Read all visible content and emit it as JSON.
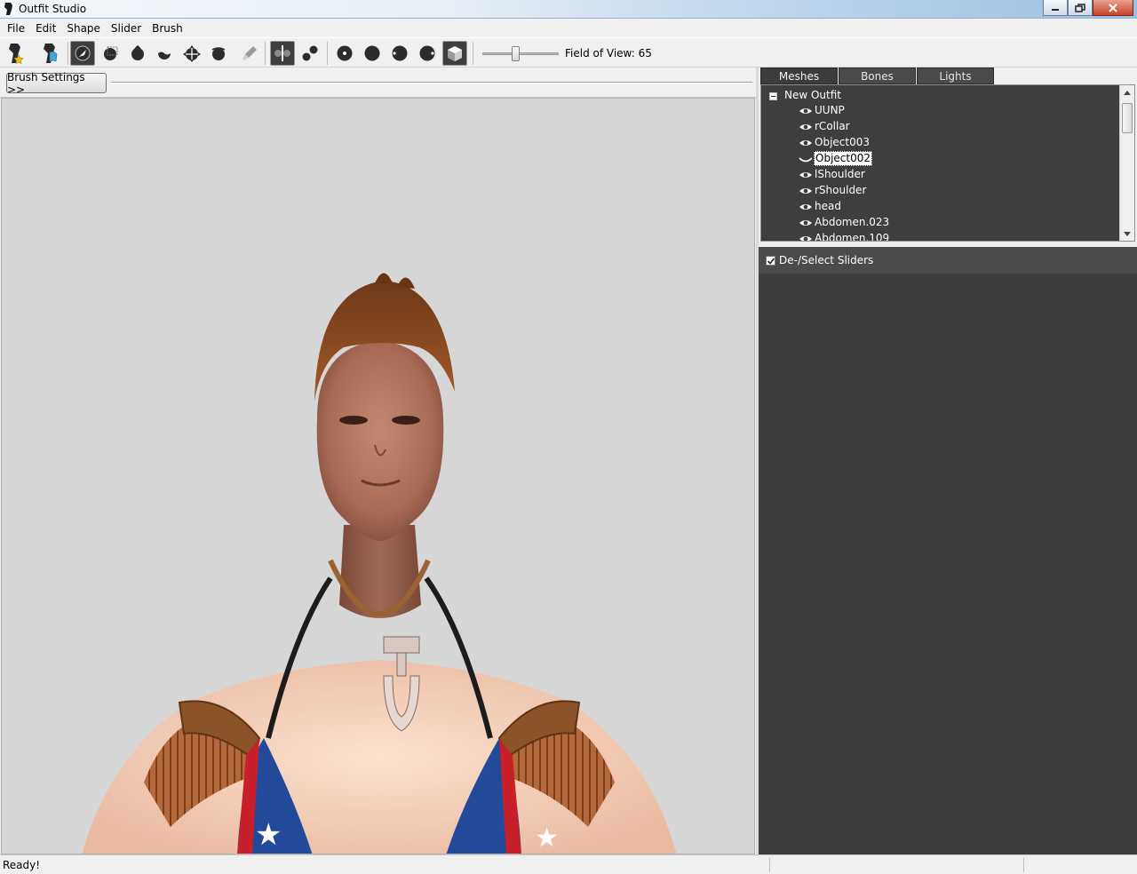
{
  "window": {
    "title": "Outfit Studio"
  },
  "menu": [
    "File",
    "Edit",
    "Shape",
    "Slider",
    "Brush"
  ],
  "toolbar": {
    "field_of_view_label": "Field of View: 65",
    "field_of_view_value": 65,
    "field_of_view_slider_fraction": 0.43,
    "tools": [
      "new-project-icon",
      "load-outfit-icon",
      "select-brush-icon",
      "mask-brush-icon",
      "inflate-brush-icon",
      "deflate-brush-icon",
      "move-brush-icon",
      "smooth-brush-icon",
      "weight-paint-brush-icon",
      "x-mirror-icon",
      "connected-only-icon",
      "front-view-icon",
      "back-view-icon",
      "left-view-icon",
      "right-view-icon",
      "perspective-toggle-icon"
    ]
  },
  "left_pane": {
    "brush_settings_label": "Brush Settings >>"
  },
  "right_pane": {
    "tabs": [
      "Meshes",
      "Bones",
      "Lights"
    ],
    "active_tab": "Meshes",
    "tree": {
      "root": "New Outfit",
      "items": [
        {
          "label": "UUNP",
          "visibility": "visible"
        },
        {
          "label": "rCollar",
          "visibility": "visible"
        },
        {
          "label": "Object003",
          "visibility": "visible"
        },
        {
          "label": "Object002",
          "visibility": "hidden",
          "selected": true
        },
        {
          "label": "lShoulder",
          "visibility": "visible"
        },
        {
          "label": "rShoulder",
          "visibility": "visible"
        },
        {
          "label": "head",
          "visibility": "visible"
        },
        {
          "label": "Abdomen.023",
          "visibility": "visible"
        },
        {
          "label": "Abdomen.109",
          "visibility": "visible"
        }
      ]
    },
    "sliders_header": "De-/Select Sliders",
    "sliders_checkbox_checked": true
  },
  "statusbar": {
    "text": "Ready!"
  },
  "colors": {
    "panel_dark": "#3e3e3e",
    "viewport_bg": "#d6d6d6",
    "skin": "#c9876a",
    "hair": "#8a4a22"
  }
}
